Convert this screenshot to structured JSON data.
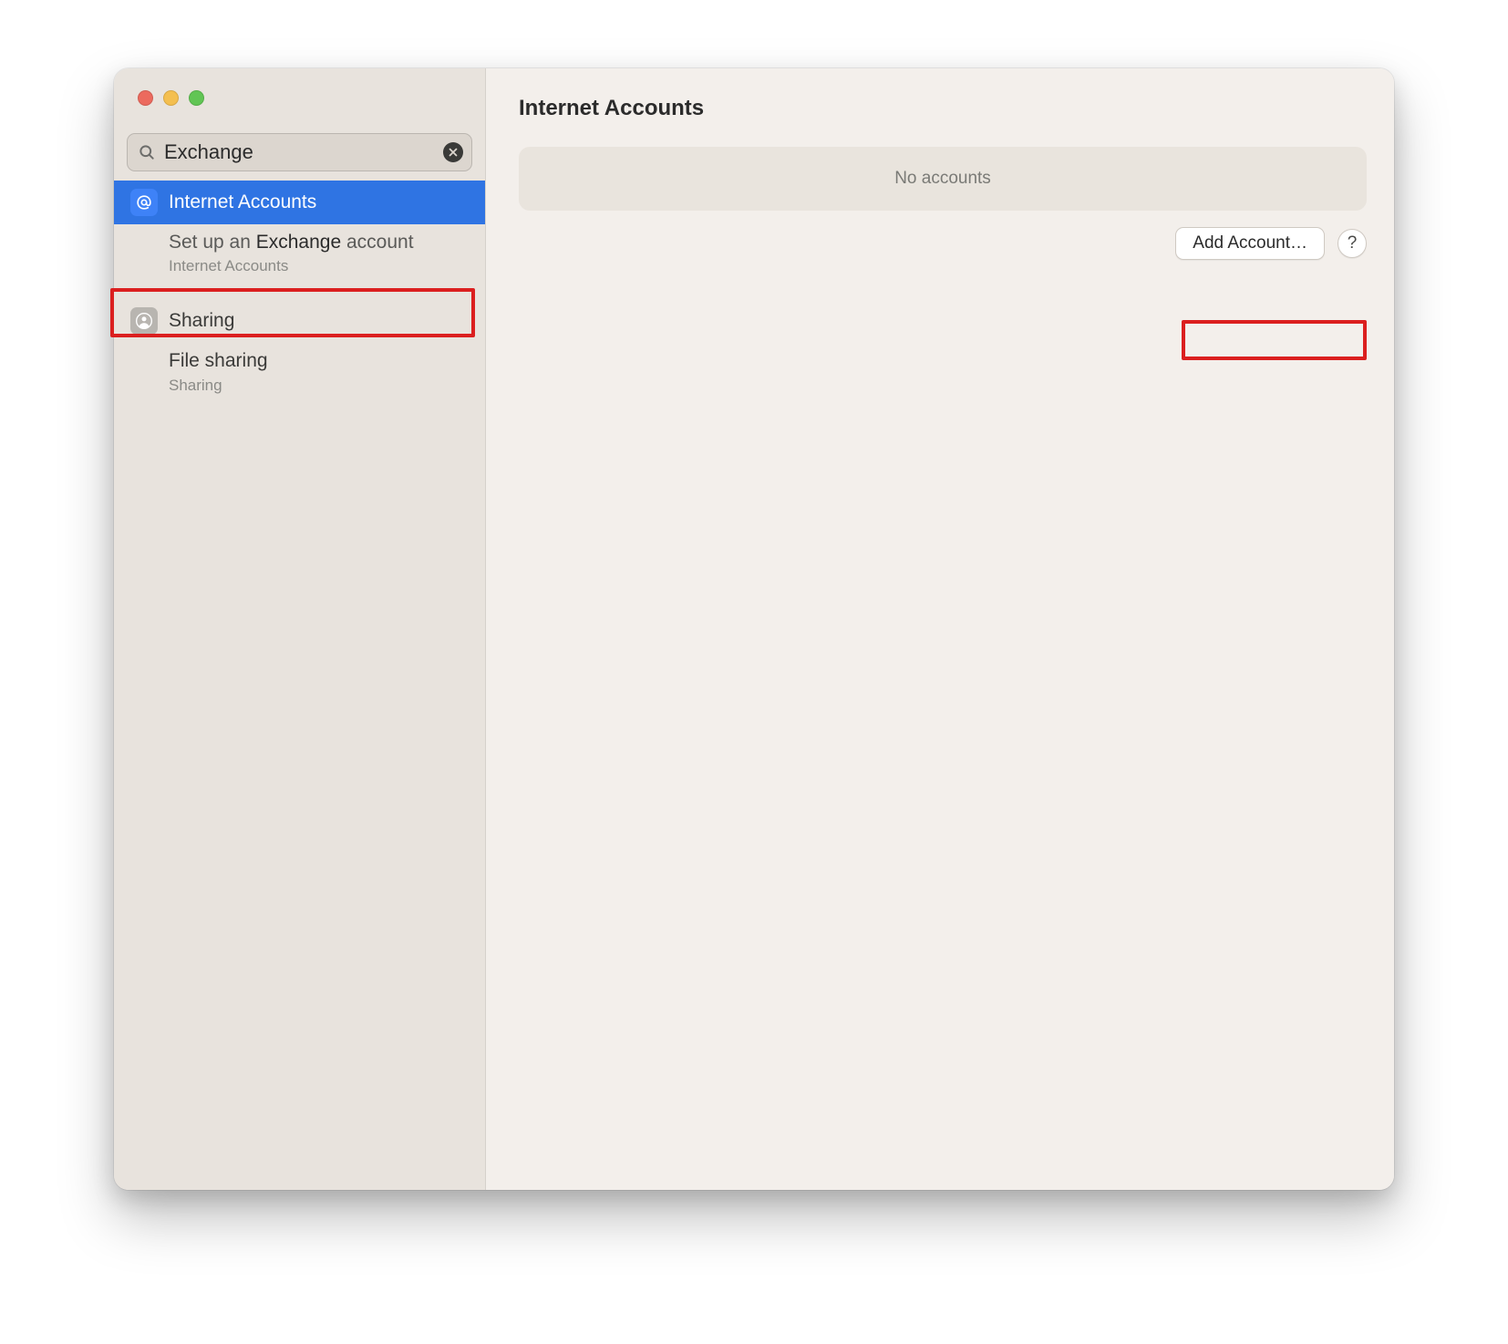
{
  "search": {
    "value": "Exchange"
  },
  "sidebar": {
    "results": [
      {
        "icon": "at-icon",
        "label": "Internet Accounts",
        "selected": true,
        "sub_prefix": "Set up an ",
        "sub_bold": "Exchange",
        "sub_suffix": " account",
        "sub_sub": "Internet Accounts"
      },
      {
        "icon": "person-icon",
        "label": "Sharing",
        "selected": false,
        "sub_prefix": "",
        "sub_bold": "File sharing",
        "sub_suffix": "",
        "sub_sub": "Sharing"
      }
    ]
  },
  "content": {
    "title": "Internet Accounts",
    "no_accounts_text": "No accounts",
    "add_account_label": "Add Account…",
    "help_label": "?"
  }
}
